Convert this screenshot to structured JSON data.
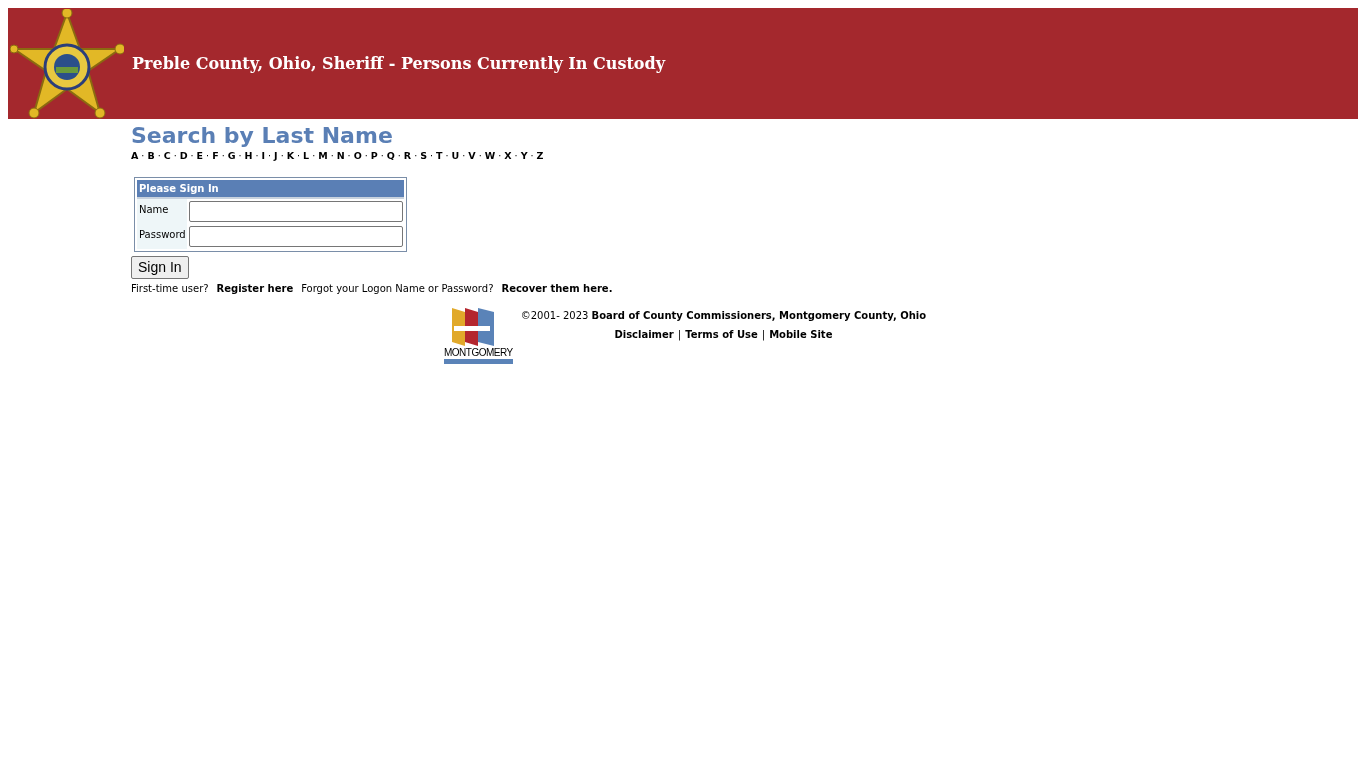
{
  "header": {
    "title": "Preble County, Ohio, Sheriff - Persons Currently In Custody"
  },
  "search": {
    "heading": "Search by Last Name",
    "separator": "·",
    "letters": [
      "A",
      "B",
      "C",
      "D",
      "E",
      "F",
      "G",
      "H",
      "I",
      "J",
      "K",
      "L",
      "M",
      "N",
      "O",
      "P",
      "Q",
      "R",
      "S",
      "T",
      "U",
      "V",
      "W",
      "X",
      "Y",
      "Z"
    ]
  },
  "signin": {
    "title": "Please Sign In",
    "fields": [
      {
        "label": "Name"
      },
      {
        "label": "Password"
      }
    ],
    "button": "Sign In"
  },
  "help": [
    {
      "kind": "text",
      "text": "First-time user?"
    },
    {
      "kind": "link",
      "text": "Register here"
    },
    {
      "kind": "text",
      "text": "Forgot your Logon Name or Password?"
    },
    {
      "kind": "link",
      "text": "Recover them here."
    }
  ],
  "footer": {
    "logo_text": "MONTGOMERY",
    "copyright": "©2001- 2023 **Board of County Commissioners, Montgomery County, Ohio**",
    "separator": "|",
    "links": [
      "Disclaimer",
      "Terms of Use",
      "Mobile Site"
    ]
  }
}
